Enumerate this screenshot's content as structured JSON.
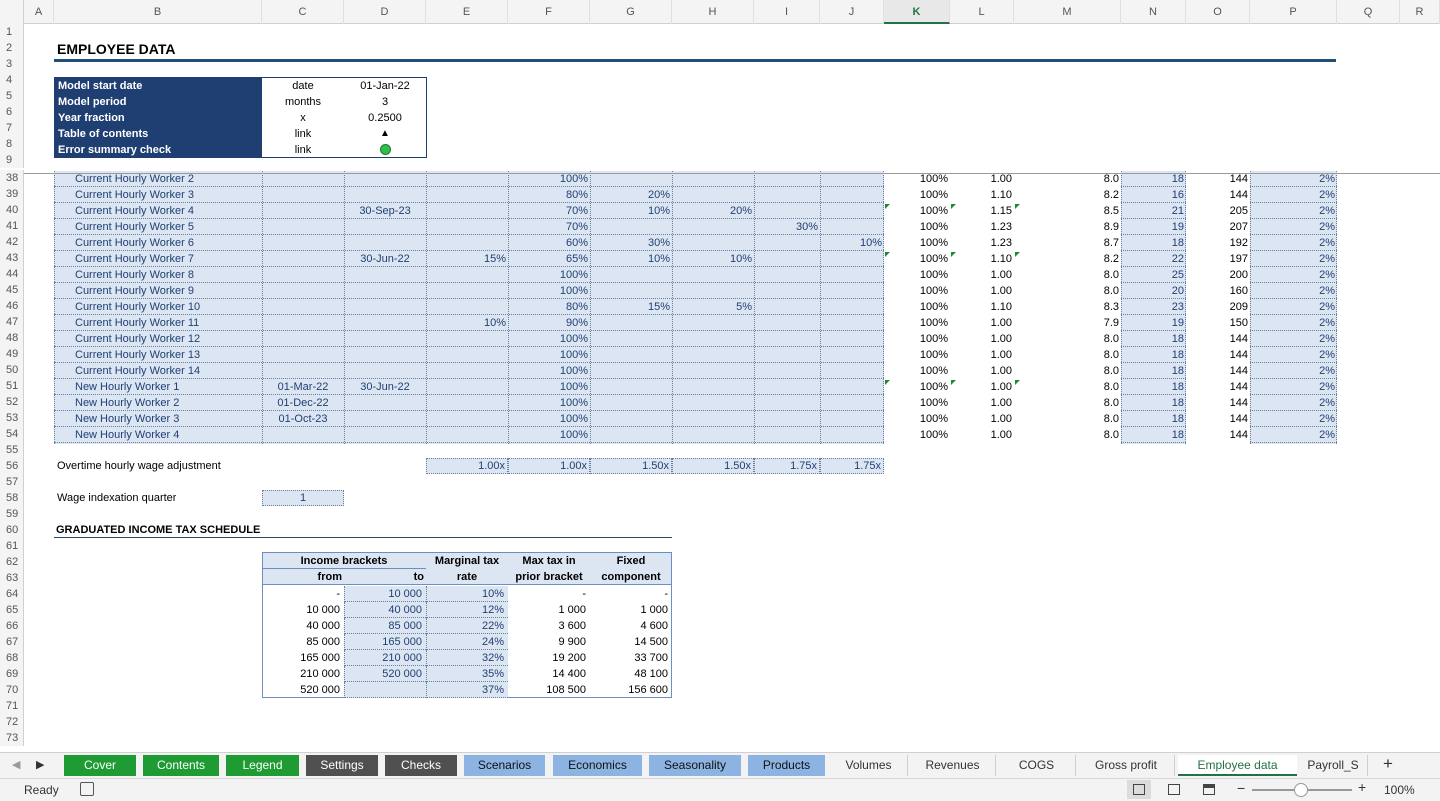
{
  "columns": [
    "A",
    "B",
    "C",
    "D",
    "E",
    "F",
    "G",
    "H",
    "I",
    "J",
    "K",
    "L",
    "M",
    "N",
    "O",
    "P",
    "Q",
    "R"
  ],
  "active_column": "K",
  "rows_top": [
    "1",
    "2",
    "3",
    "4",
    "5",
    "6",
    "7",
    "8",
    "9"
  ],
  "rows_bottom": [
    "38",
    "39",
    "40",
    "41",
    "42",
    "43",
    "44",
    "45",
    "46",
    "47",
    "48",
    "49",
    "50",
    "51",
    "52",
    "53",
    "54",
    "55",
    "56",
    "57",
    "58",
    "59",
    "60",
    "61",
    "62",
    "63",
    "64",
    "65",
    "66",
    "67",
    "68",
    "69",
    "70",
    "71",
    "72",
    "73"
  ],
  "title": "EMPLOYEE DATA",
  "model_info": [
    {
      "label": "Model start date",
      "unit": "date",
      "value": "01-Jan-22"
    },
    {
      "label": "Model period",
      "unit": "months",
      "value": "3"
    },
    {
      "label": "Year fraction",
      "unit": "x",
      "value": "0.2500"
    },
    {
      "label": "Table of contents",
      "unit": "link",
      "value": "▲"
    },
    {
      "label": "Error summary check",
      "unit": "link",
      "value": ""
    }
  ],
  "workers": [
    {
      "name": "Current Hourly Worker 2",
      "c": "",
      "d": "",
      "e": "",
      "f": "100%",
      "g": "",
      "h": "",
      "i": "",
      "j": "",
      "k": "100%",
      "l": "1.00",
      "m": "8.0",
      "n": "18",
      "o": "144",
      "p": "2%"
    },
    {
      "name": "Current Hourly Worker 3",
      "c": "",
      "d": "",
      "e": "",
      "f": "80%",
      "g": "20%",
      "h": "",
      "i": "",
      "j": "",
      "k": "100%",
      "l": "1.10",
      "m": "8.2",
      "n": "16",
      "o": "144",
      "p": "2%"
    },
    {
      "name": "Current Hourly Worker 4",
      "c": "",
      "d": "30-Sep-23",
      "e": "",
      "f": "70%",
      "g": "10%",
      "h": "20%",
      "i": "",
      "j": "",
      "k": "100%",
      "l": "1.15",
      "m": "8.5",
      "n": "21",
      "o": "205",
      "p": "2%"
    },
    {
      "name": "Current Hourly Worker 5",
      "c": "",
      "d": "",
      "e": "",
      "f": "70%",
      "g": "",
      "h": "",
      "i": "30%",
      "j": "",
      "k": "100%",
      "l": "1.23",
      "m": "8.9",
      "n": "19",
      "o": "207",
      "p": "2%"
    },
    {
      "name": "Current Hourly Worker 6",
      "c": "",
      "d": "",
      "e": "",
      "f": "60%",
      "g": "30%",
      "h": "",
      "i": "",
      "j": "10%",
      "k": "100%",
      "l": "1.23",
      "m": "8.7",
      "n": "18",
      "o": "192",
      "p": "2%"
    },
    {
      "name": "Current Hourly Worker 7",
      "c": "",
      "d": "30-Jun-22",
      "e": "15%",
      "f": "65%",
      "g": "10%",
      "h": "10%",
      "i": "",
      "j": "",
      "k": "100%",
      "l": "1.10",
      "m": "8.2",
      "n": "22",
      "o": "197",
      "p": "2%"
    },
    {
      "name": "Current Hourly Worker 8",
      "c": "",
      "d": "",
      "e": "",
      "f": "100%",
      "g": "",
      "h": "",
      "i": "",
      "j": "",
      "k": "100%",
      "l": "1.00",
      "m": "8.0",
      "n": "25",
      "o": "200",
      "p": "2%"
    },
    {
      "name": "Current Hourly Worker 9",
      "c": "",
      "d": "",
      "e": "",
      "f": "100%",
      "g": "",
      "h": "",
      "i": "",
      "j": "",
      "k": "100%",
      "l": "1.00",
      "m": "8.0",
      "n": "20",
      "o": "160",
      "p": "2%"
    },
    {
      "name": "Current Hourly Worker 10",
      "c": "",
      "d": "",
      "e": "",
      "f": "80%",
      "g": "15%",
      "h": "5%",
      "i": "",
      "j": "",
      "k": "100%",
      "l": "1.10",
      "m": "8.3",
      "n": "23",
      "o": "209",
      "p": "2%"
    },
    {
      "name": "Current Hourly Worker 11",
      "c": "",
      "d": "",
      "e": "10%",
      "f": "90%",
      "g": "",
      "h": "",
      "i": "",
      "j": "",
      "k": "100%",
      "l": "1.00",
      "m": "7.9",
      "n": "19",
      "o": "150",
      "p": "2%"
    },
    {
      "name": "Current Hourly Worker 12",
      "c": "",
      "d": "",
      "e": "",
      "f": "100%",
      "g": "",
      "h": "",
      "i": "",
      "j": "",
      "k": "100%",
      "l": "1.00",
      "m": "8.0",
      "n": "18",
      "o": "144",
      "p": "2%"
    },
    {
      "name": "Current Hourly Worker 13",
      "c": "",
      "d": "",
      "e": "",
      "f": "100%",
      "g": "",
      "h": "",
      "i": "",
      "j": "",
      "k": "100%",
      "l": "1.00",
      "m": "8.0",
      "n": "18",
      "o": "144",
      "p": "2%"
    },
    {
      "name": "Current Hourly Worker 14",
      "c": "",
      "d": "",
      "e": "",
      "f": "100%",
      "g": "",
      "h": "",
      "i": "",
      "j": "",
      "k": "100%",
      "l": "1.00",
      "m": "8.0",
      "n": "18",
      "o": "144",
      "p": "2%"
    },
    {
      "name": "New Hourly Worker 1",
      "c": "01-Mar-22",
      "d": "30-Jun-22",
      "e": "",
      "f": "100%",
      "g": "",
      "h": "",
      "i": "",
      "j": "",
      "k": "100%",
      "l": "1.00",
      "m": "8.0",
      "n": "18",
      "o": "144",
      "p": "2%"
    },
    {
      "name": "New Hourly Worker 2",
      "c": "01-Dec-22",
      "d": "",
      "e": "",
      "f": "100%",
      "g": "",
      "h": "",
      "i": "",
      "j": "",
      "k": "100%",
      "l": "1.00",
      "m": "8.0",
      "n": "18",
      "o": "144",
      "p": "2%"
    },
    {
      "name": "New Hourly Worker 3",
      "c": "01-Oct-23",
      "d": "",
      "e": "",
      "f": "100%",
      "g": "",
      "h": "",
      "i": "",
      "j": "",
      "k": "100%",
      "l": "1.00",
      "m": "8.0",
      "n": "18",
      "o": "144",
      "p": "2%"
    },
    {
      "name": "New Hourly Worker 4",
      "c": "",
      "d": "",
      "e": "",
      "f": "100%",
      "g": "",
      "h": "",
      "i": "",
      "j": "",
      "k": "100%",
      "l": "1.00",
      "m": "8.0",
      "n": "18",
      "o": "144",
      "p": "2%"
    }
  ],
  "overtime": {
    "label": "Overtime hourly wage adjustment",
    "values": [
      "1.00x",
      "1.00x",
      "1.50x",
      "1.50x",
      "1.75x",
      "1.75x"
    ]
  },
  "wage_index": {
    "label": "Wage indexation quarter",
    "value": "1"
  },
  "tax": {
    "title": "GRADUATED INCOME TAX SCHEDULE",
    "header_top": [
      "Income brackets",
      "Marginal tax",
      "Max tax in",
      "Fixed"
    ],
    "header_bottom": [
      "from",
      "to",
      "rate",
      "prior bracket",
      "component"
    ],
    "rows": [
      [
        "-",
        "10 000",
        "10%",
        "-",
        "-"
      ],
      [
        "10 000",
        "40 000",
        "12%",
        "1 000",
        "1 000"
      ],
      [
        "40 000",
        "85 000",
        "22%",
        "3 600",
        "4 600"
      ],
      [
        "85 000",
        "165 000",
        "24%",
        "9 900",
        "14 500"
      ],
      [
        "165 000",
        "210 000",
        "32%",
        "19 200",
        "33 700"
      ],
      [
        "210 000",
        "520 000",
        "35%",
        "14 400",
        "48 100"
      ],
      [
        "520 000",
        "",
        "37%",
        "108 500",
        "156 600"
      ]
    ]
  },
  "tabs": [
    {
      "label": "Cover",
      "style": "green"
    },
    {
      "label": "Contents",
      "style": "green"
    },
    {
      "label": "Legend",
      "style": "green"
    },
    {
      "label": "Settings",
      "style": "gray"
    },
    {
      "label": "Checks",
      "style": "gray"
    },
    {
      "label": "Scenarios",
      "style": "lblue"
    },
    {
      "label": "Economics",
      "style": "lblue"
    },
    {
      "label": "Seasonality",
      "style": "lblue"
    },
    {
      "label": "Products",
      "style": "lblue"
    },
    {
      "label": "Volumes",
      "style": "plain"
    },
    {
      "label": "Revenues",
      "style": "plain"
    },
    {
      "label": "COGS",
      "style": "plain"
    },
    {
      "label": "Gross profit",
      "style": "plain"
    },
    {
      "label": "Employee data",
      "style": "active"
    },
    {
      "label": "Payroll_S",
      "style": "plain"
    }
  ],
  "status": {
    "ready": "Ready",
    "zoom": "100%"
  },
  "colors": {
    "navy": "#1f3f73",
    "input_fill": "#dce6f2",
    "excel_green": "#217346",
    "tab_green": "#1e9b33",
    "tab_gray": "#505050",
    "tab_blue": "#8db3e2"
  }
}
